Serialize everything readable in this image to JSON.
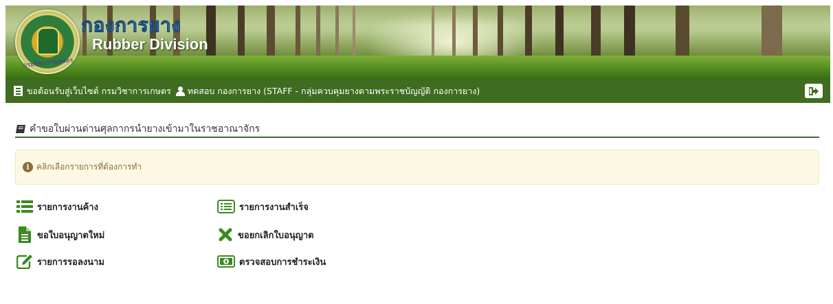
{
  "banner": {
    "title_thai": "กองการยาง",
    "title_english": "Rubber Division",
    "seal_text": "กรมวิชาการเกษตร"
  },
  "navbar": {
    "welcome_text": "ขอต้อนรับสู่เว็บไซต์ กรมวิชาการเกษตร",
    "user_text": "ทดสอบ กองการยาง (STAFF - กลุ่มควบคุมยางตามพระราชบัญญัติ กองการยาง)"
  },
  "page": {
    "title": "คำขอใบผ่านด่านศุลกากรนำยางเข้ามาในราชอาณาจักร",
    "alert_text": "คลิกเลือกรายการที่ต้องการทำ"
  },
  "menu": {
    "pending_list": "รายการงานค้าง",
    "completed_list": "รายการงานสำเร็จ",
    "new_license": "ขอใบอนุญาตใหม่",
    "cancel_license": "ขอยกเลิกใบอนุญาต",
    "pending_signature": "รายการรอลงนาม",
    "check_payment": "ตรวจสอบการชำระเงิน"
  },
  "colors": {
    "nav_green": "#3f6c20",
    "icon_green": "#3a8a1f",
    "alert_bg": "#fcf8e3",
    "alert_text": "#8a6d3b"
  }
}
